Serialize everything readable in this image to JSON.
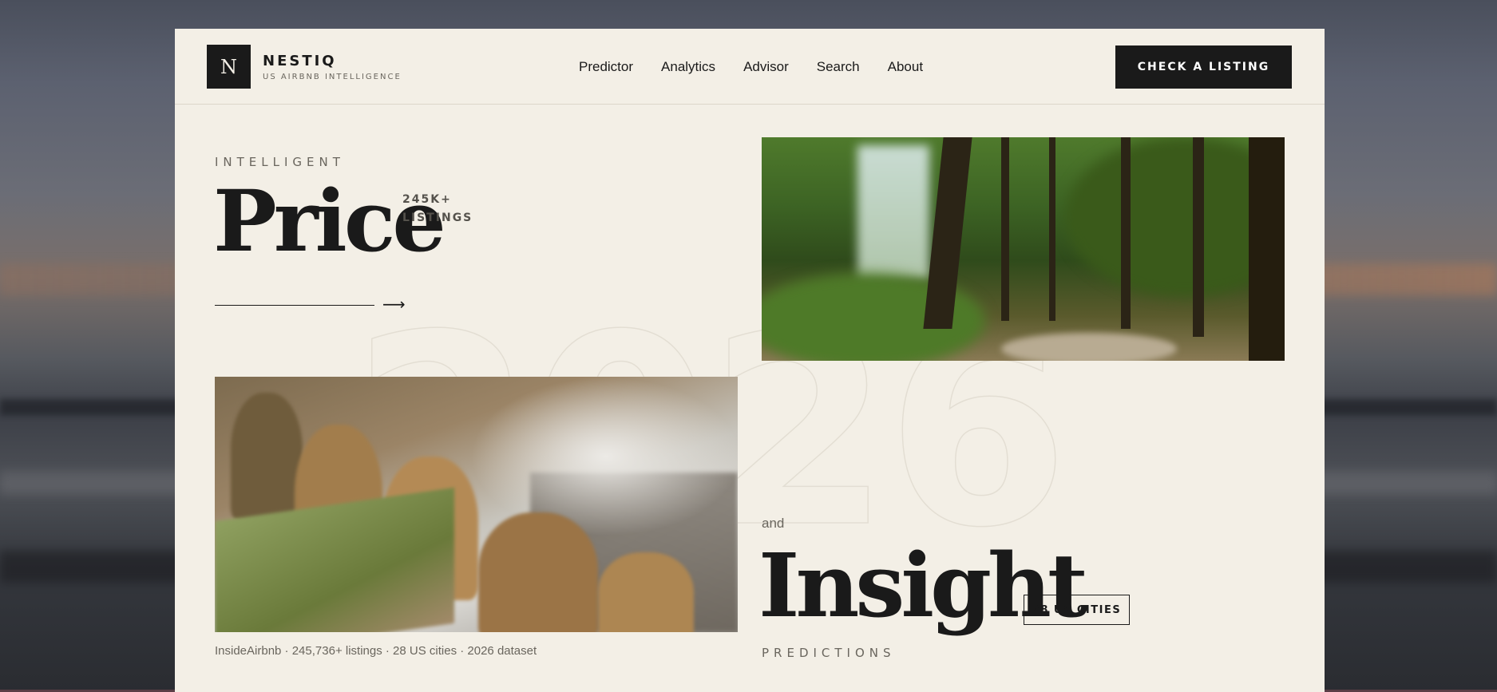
{
  "brand": {
    "logo_letter": "N",
    "name": "NESTIQ",
    "tagline": "US AIRBNB INTELLIGENCE"
  },
  "nav": {
    "items": [
      "Predictor",
      "Analytics",
      "Advisor",
      "Search",
      "About"
    ]
  },
  "cta": {
    "label": "CHECK A LISTING"
  },
  "hero": {
    "kicker": "INTELLIGENT",
    "headline_1": "Price",
    "stat_value": "245K+",
    "stat_label": "LISTINGS",
    "arrow": "⟶",
    "year": "2026",
    "connector": "and",
    "headline_2": "Insight",
    "cities_badge": "28 US CITIES",
    "predictions": "PREDICTIONS"
  },
  "caption": "InsideAirbnb · 245,736+ listings · 28 US cities · 2026 dataset",
  "colors": {
    "card_bg": "#f3efe6",
    "ink": "#1a1a1a",
    "muted": "#6a665e",
    "cta_bg": "#1a1a1a",
    "cta_text": "#ffffff"
  }
}
